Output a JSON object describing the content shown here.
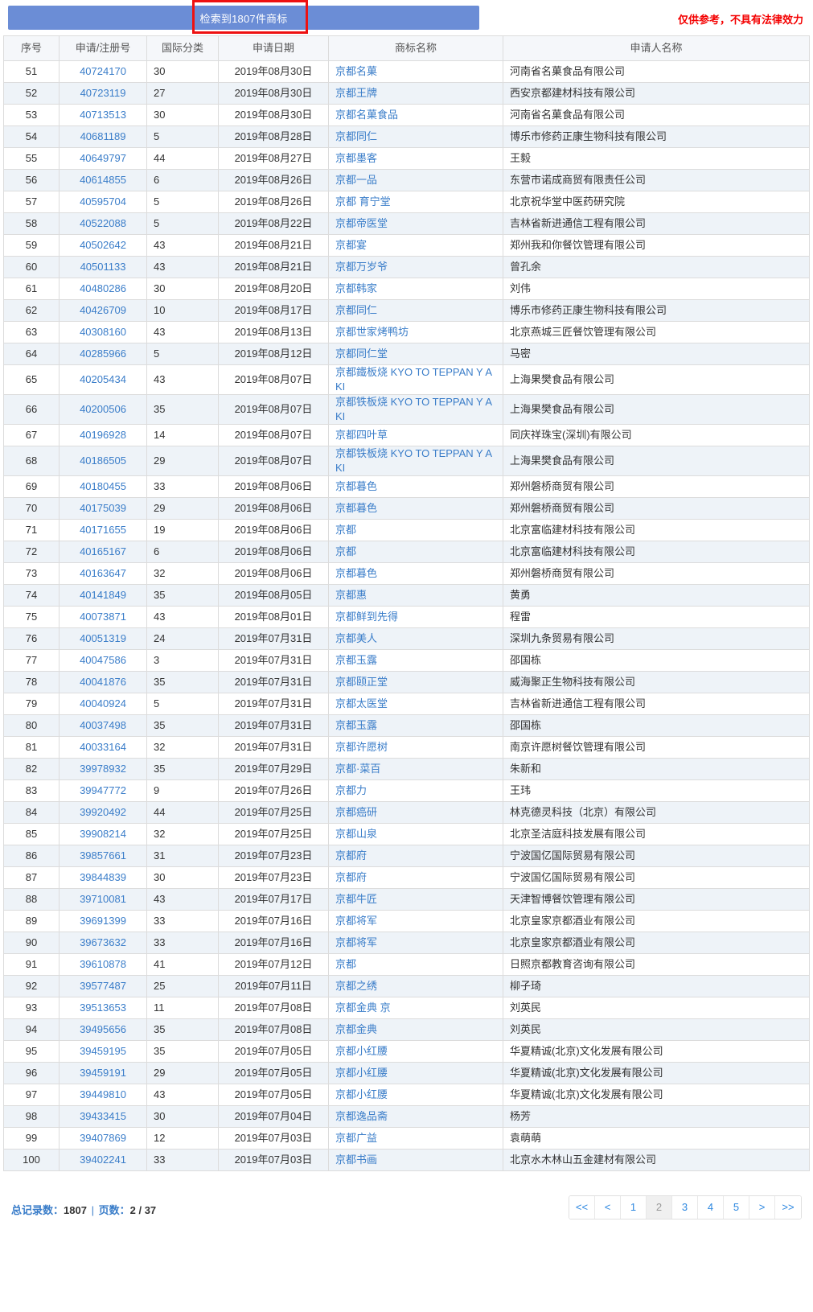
{
  "banner": {
    "text": "检索到1807件商标",
    "color": "#6b8dd6",
    "highlight_box_color": "#ee1111"
  },
  "legal_note": {
    "text": "仅供参考，不具有法律效力",
    "color": "#f40000"
  },
  "table": {
    "columns": [
      "序号",
      "申请/注册号",
      "国际分类",
      "申请日期",
      "商标名称",
      "申请人名称"
    ],
    "rows": [
      {
        "seq": "51",
        "regno": "40724170",
        "cls": "30",
        "date": "2019年08月30日",
        "name": "京都名菓",
        "applicant": "河南省名菓食品有限公司"
      },
      {
        "seq": "52",
        "regno": "40723119",
        "cls": "27",
        "date": "2019年08月30日",
        "name": "京都王牌",
        "applicant": "西安京都建材科技有限公司"
      },
      {
        "seq": "53",
        "regno": "40713513",
        "cls": "30",
        "date": "2019年08月30日",
        "name": "京都名菓食品",
        "applicant": "河南省名菓食品有限公司"
      },
      {
        "seq": "54",
        "regno": "40681189",
        "cls": "5",
        "date": "2019年08月28日",
        "name": "京都同仁",
        "applicant": "博乐市修药正康生物科技有限公司"
      },
      {
        "seq": "55",
        "regno": "40649797",
        "cls": "44",
        "date": "2019年08月27日",
        "name": "京都墨客",
        "applicant": "王毅"
      },
      {
        "seq": "56",
        "regno": "40614855",
        "cls": "6",
        "date": "2019年08月26日",
        "name": "京都一品",
        "applicant": "东营市诺成商贸有限责任公司"
      },
      {
        "seq": "57",
        "regno": "40595704",
        "cls": "5",
        "date": "2019年08月26日",
        "name": "京都 育宁堂",
        "applicant": "北京祝华堂中医药研究院"
      },
      {
        "seq": "58",
        "regno": "40522088",
        "cls": "5",
        "date": "2019年08月22日",
        "name": "京都帝医堂",
        "applicant": "吉林省新进通信工程有限公司"
      },
      {
        "seq": "59",
        "regno": "40502642",
        "cls": "43",
        "date": "2019年08月21日",
        "name": "京都宴",
        "applicant": "郑州我和你餐饮管理有限公司"
      },
      {
        "seq": "60",
        "regno": "40501133",
        "cls": "43",
        "date": "2019年08月21日",
        "name": "京都万岁爷",
        "applicant": "曾孔余"
      },
      {
        "seq": "61",
        "regno": "40480286",
        "cls": "30",
        "date": "2019年08月20日",
        "name": "京都韩家",
        "applicant": "刘伟"
      },
      {
        "seq": "62",
        "regno": "40426709",
        "cls": "10",
        "date": "2019年08月17日",
        "name": "京都同仁",
        "applicant": "博乐市修药正康生物科技有限公司"
      },
      {
        "seq": "63",
        "regno": "40308160",
        "cls": "43",
        "date": "2019年08月13日",
        "name": "京都世家烤鸭坊",
        "applicant": "北京燕城三匠餐饮管理有限公司"
      },
      {
        "seq": "64",
        "regno": "40285966",
        "cls": "5",
        "date": "2019年08月12日",
        "name": "京都同仁堂",
        "applicant": "马密"
      },
      {
        "seq": "65",
        "regno": "40205434",
        "cls": "43",
        "date": "2019年08月07日",
        "name": "京都鐵板烧 KYO TO TEPPAN Y A KI",
        "applicant": "上海果樊食品有限公司"
      },
      {
        "seq": "66",
        "regno": "40200506",
        "cls": "35",
        "date": "2019年08月07日",
        "name": "京都铁板烧 KYO TO TEPPAN Y A KI",
        "applicant": "上海果樊食品有限公司"
      },
      {
        "seq": "67",
        "regno": "40196928",
        "cls": "14",
        "date": "2019年08月07日",
        "name": "京都四叶草",
        "applicant": "同庆祥珠宝(深圳)有限公司"
      },
      {
        "seq": "68",
        "regno": "40186505",
        "cls": "29",
        "date": "2019年08月07日",
        "name": "京都铁板烧 KYO TO TEPPAN Y A KI",
        "applicant": "上海果樊食品有限公司"
      },
      {
        "seq": "69",
        "regno": "40180455",
        "cls": "33",
        "date": "2019年08月06日",
        "name": "京都暮色",
        "applicant": "郑州磐桥商贸有限公司"
      },
      {
        "seq": "70",
        "regno": "40175039",
        "cls": "29",
        "date": "2019年08月06日",
        "name": "京都暮色",
        "applicant": "郑州磐桥商贸有限公司"
      },
      {
        "seq": "71",
        "regno": "40171655",
        "cls": "19",
        "date": "2019年08月06日",
        "name": "京都",
        "applicant": "北京富临建材科技有限公司"
      },
      {
        "seq": "72",
        "regno": "40165167",
        "cls": "6",
        "date": "2019年08月06日",
        "name": "京都",
        "applicant": "北京富临建材科技有限公司"
      },
      {
        "seq": "73",
        "regno": "40163647",
        "cls": "32",
        "date": "2019年08月06日",
        "name": "京都暮色",
        "applicant": "郑州磐桥商贸有限公司"
      },
      {
        "seq": "74",
        "regno": "40141849",
        "cls": "35",
        "date": "2019年08月05日",
        "name": "京都惠",
        "applicant": "黄勇"
      },
      {
        "seq": "75",
        "regno": "40073871",
        "cls": "43",
        "date": "2019年08月01日",
        "name": "京都鲜到先得",
        "applicant": "程雷"
      },
      {
        "seq": "76",
        "regno": "40051319",
        "cls": "24",
        "date": "2019年07月31日",
        "name": "京都美人",
        "applicant": "深圳九条贸易有限公司"
      },
      {
        "seq": "77",
        "regno": "40047586",
        "cls": "3",
        "date": "2019年07月31日",
        "name": "京都玉露",
        "applicant": "邵国栋"
      },
      {
        "seq": "78",
        "regno": "40041876",
        "cls": "35",
        "date": "2019年07月31日",
        "name": "京都颐正堂",
        "applicant": "威海聚正生物科技有限公司"
      },
      {
        "seq": "79",
        "regno": "40040924",
        "cls": "5",
        "date": "2019年07月31日",
        "name": "京都太医堂",
        "applicant": "吉林省新进通信工程有限公司"
      },
      {
        "seq": "80",
        "regno": "40037498",
        "cls": "35",
        "date": "2019年07月31日",
        "name": "京都玉露",
        "applicant": "邵国栋"
      },
      {
        "seq": "81",
        "regno": "40033164",
        "cls": "32",
        "date": "2019年07月31日",
        "name": "京都许愿树",
        "applicant": "南京许愿树餐饮管理有限公司"
      },
      {
        "seq": "82",
        "regno": "39978932",
        "cls": "35",
        "date": "2019年07月29日",
        "name": "京都·菜百",
        "applicant": "朱新和"
      },
      {
        "seq": "83",
        "regno": "39947772",
        "cls": "9",
        "date": "2019年07月26日",
        "name": "京都力",
        "applicant": "王玮"
      },
      {
        "seq": "84",
        "regno": "39920492",
        "cls": "44",
        "date": "2019年07月25日",
        "name": "京都癌研",
        "applicant": "林克德灵科技（北京）有限公司"
      },
      {
        "seq": "85",
        "regno": "39908214",
        "cls": "32",
        "date": "2019年07月25日",
        "name": "京都山泉",
        "applicant": "北京圣洁庭科技发展有限公司"
      },
      {
        "seq": "86",
        "regno": "39857661",
        "cls": "31",
        "date": "2019年07月23日",
        "name": "京都府",
        "applicant": "宁波国亿国际贸易有限公司"
      },
      {
        "seq": "87",
        "regno": "39844839",
        "cls": "30",
        "date": "2019年07月23日",
        "name": "京都府",
        "applicant": "宁波国亿国际贸易有限公司"
      },
      {
        "seq": "88",
        "regno": "39710081",
        "cls": "43",
        "date": "2019年07月17日",
        "name": "京都牛匠",
        "applicant": "天津智博餐饮管理有限公司"
      },
      {
        "seq": "89",
        "regno": "39691399",
        "cls": "33",
        "date": "2019年07月16日",
        "name": "京都将军",
        "applicant": "北京皇家京都酒业有限公司"
      },
      {
        "seq": "90",
        "regno": "39673632",
        "cls": "33",
        "date": "2019年07月16日",
        "name": "京都将军",
        "applicant": "北京皇家京都酒业有限公司"
      },
      {
        "seq": "91",
        "regno": "39610878",
        "cls": "41",
        "date": "2019年07月12日",
        "name": "京都",
        "applicant": "日照京都教育咨询有限公司"
      },
      {
        "seq": "92",
        "regno": "39577487",
        "cls": "25",
        "date": "2019年07月11日",
        "name": "京都之绣",
        "applicant": "柳子琦"
      },
      {
        "seq": "93",
        "regno": "39513653",
        "cls": "11",
        "date": "2019年07月08日",
        "name": "京都金典 京",
        "applicant": "刘英民"
      },
      {
        "seq": "94",
        "regno": "39495656",
        "cls": "35",
        "date": "2019年07月08日",
        "name": "京都金典",
        "applicant": "刘英民"
      },
      {
        "seq": "95",
        "regno": "39459195",
        "cls": "35",
        "date": "2019年07月05日",
        "name": "京都小红腰",
        "applicant": "华夏精诚(北京)文化发展有限公司"
      },
      {
        "seq": "96",
        "regno": "39459191",
        "cls": "29",
        "date": "2019年07月05日",
        "name": "京都小红腰",
        "applicant": "华夏精诚(北京)文化发展有限公司"
      },
      {
        "seq": "97",
        "regno": "39449810",
        "cls": "43",
        "date": "2019年07月05日",
        "name": "京都小红腰",
        "applicant": "华夏精诚(北京)文化发展有限公司"
      },
      {
        "seq": "98",
        "regno": "39433415",
        "cls": "30",
        "date": "2019年07月04日",
        "name": "京都逸品斋",
        "applicant": "杨芳"
      },
      {
        "seq": "99",
        "regno": "39407869",
        "cls": "12",
        "date": "2019年07月03日",
        "name": "京都广益",
        "applicant": "袁萌萌"
      },
      {
        "seq": "100",
        "regno": "39402241",
        "cls": "33",
        "date": "2019年07月03日",
        "name": "京都书画",
        "applicant": "北京水木林山五金建材有限公司"
      }
    ]
  },
  "footer": {
    "total_label": "总记录数",
    "total_value": "1807",
    "page_label": "页数",
    "page_value": "2 / 37",
    "separator": "|",
    "colon": "：",
    "pager": [
      {
        "label": "<<",
        "name": "first",
        "current": false
      },
      {
        "label": "<",
        "name": "prev",
        "current": false
      },
      {
        "label": "1",
        "name": "page-1",
        "current": false
      },
      {
        "label": "2",
        "name": "page-2",
        "current": true
      },
      {
        "label": "3",
        "name": "page-3",
        "current": false
      },
      {
        "label": "4",
        "name": "page-4",
        "current": false
      },
      {
        "label": "5",
        "name": "page-5",
        "current": false
      },
      {
        "label": ">",
        "name": "next",
        "current": false
      },
      {
        "label": ">>",
        "name": "last",
        "current": false
      }
    ]
  }
}
